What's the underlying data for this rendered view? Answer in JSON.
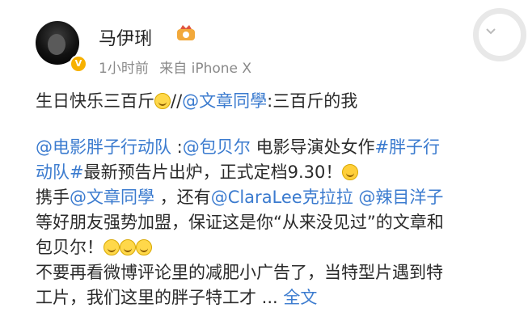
{
  "post": {
    "user_name": "马伊琍",
    "time": "1小时前",
    "source": "来自 iPhone X",
    "line1_prefix": "生日快乐三百斤",
    "line1_sep": "//",
    "line1_mention": "@文章同學",
    "line1_suffix": ":三百斤的我",
    "p_mention1": "@电影胖子行动队",
    "p_colon": " :",
    "p_mention2": "@包贝尔",
    "p_text1": " 电影导演处女作",
    "p_topic_a": "#胖子行",
    "p_topic_b": "动队#",
    "p_text2": "最新预告片出炉，正式定档9.30！",
    "p_text3": "携手",
    "p_mention3": "@文章同學",
    "p_text4": " ，还有",
    "p_mention4": "@ClaraLee克拉拉",
    "p_mention5": "@辣目洋子",
    "p_text5": "等好朋友强势加盟，保证这是你“从来没见过”的文章和",
    "p_text6": "包贝尔！",
    "p_text7": "不要再看微博评论里的减肥小广告了，当特型片遇到特",
    "p_text8": "工片，我们这里的胖子特工才 ... ",
    "p_full": "全文"
  },
  "colors": {
    "link": "#3b7bcf",
    "meta": "#8a8a8a",
    "verified": "#f7b100"
  },
  "icons": [
    "avatar",
    "verified-badge-icon",
    "member-crown-icon",
    "chevron-down-icon",
    "laugh-emoji-icon",
    "shy-emoji-icon"
  ]
}
